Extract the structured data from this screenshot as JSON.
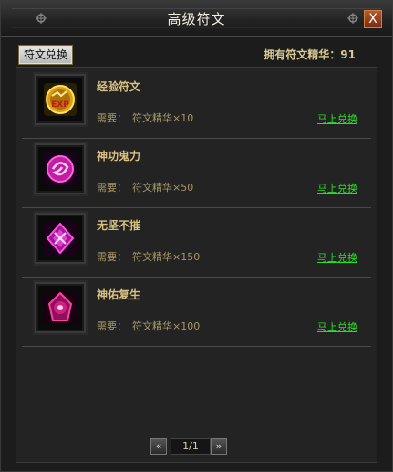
{
  "window": {
    "title": "高级符文",
    "close_label": "X"
  },
  "header": {
    "tab_label": "符文兑换",
    "essence_label": "拥有符文精华：91"
  },
  "colors": {
    "accent_green": "#28e028",
    "gold_text": "#d8c080"
  },
  "items": [
    {
      "name": "经验符文",
      "req_prefix": "需要：",
      "req_text": "符文精华×10",
      "action": "马上兑换",
      "icon": "exp-rune-icon"
    },
    {
      "name": "神功鬼力",
      "req_prefix": "需要：",
      "req_text": "符文精华×50",
      "action": "马上兑换",
      "icon": "power-rune-icon"
    },
    {
      "name": "无坚不摧",
      "req_prefix": "需要：",
      "req_text": "符文精华×150",
      "action": "马上兑换",
      "icon": "pierce-rune-icon"
    },
    {
      "name": "神佑复生",
      "req_prefix": "需要：",
      "req_text": "符文精华×100",
      "action": "马上兑换",
      "icon": "revive-rune-icon"
    }
  ],
  "pager": {
    "prev": "«",
    "next": "»",
    "page": "1/1"
  }
}
